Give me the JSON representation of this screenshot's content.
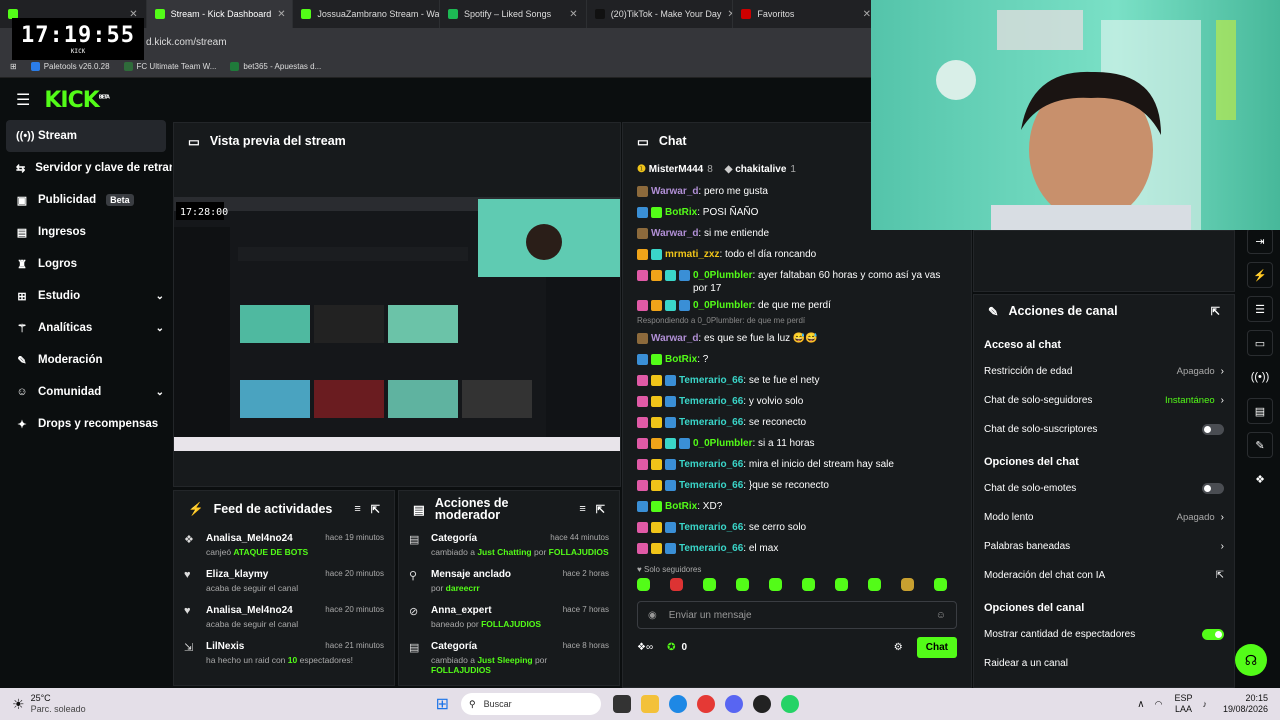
{
  "browser": {
    "tabs": [
      {
        "label": "",
        "color": "#53fc18",
        "active": false
      },
      {
        "label": "Stream - Kick Dashboard",
        "color": "#53fc18",
        "active": true
      },
      {
        "label": "JossuaZambrano Stream - Wat",
        "color": "#53fc18",
        "active": false
      },
      {
        "label": "Spotify – Liked Songs",
        "color": "#1db954",
        "active": false
      },
      {
        "label": "(20)TikTok - Make Your Day",
        "color": "#111",
        "active": false
      },
      {
        "label": "Favoritos",
        "color": "#cc0000",
        "active": false
      }
    ],
    "url": "d.kick.com/stream",
    "bookmarks": [
      "Paletools v26.0.28",
      "FC Ultimate Team W...",
      "bet365 - Apuestas d..."
    ]
  },
  "clock": {
    "time": "17:19:55",
    "sub": "KICK"
  },
  "sidebar": {
    "items": [
      {
        "label": "Stream",
        "icon": "((•))",
        "active": true
      },
      {
        "label": "Servidor y clave de retransmisión",
        "icon": "⇆"
      },
      {
        "label": "Publicidad",
        "icon": "▣",
        "badge": "Beta"
      },
      {
        "label": "Ingresos",
        "icon": "▤"
      },
      {
        "label": "Logros",
        "icon": "♜"
      },
      {
        "label": "Estudio",
        "icon": "⊞",
        "chev": true
      },
      {
        "label": "Analíticas",
        "icon": "⚚",
        "chev": true
      },
      {
        "label": "Moderación",
        "icon": "✎"
      },
      {
        "label": "Comunidad",
        "icon": "☺",
        "chev": true
      },
      {
        "label": "Drops y recompensas",
        "icon": "✦"
      }
    ]
  },
  "preview": {
    "title": "Vista previa del stream",
    "inner_time": "17:28:00"
  },
  "feed": {
    "title": "Feed de actividades",
    "rows": [
      {
        "icon": "❖",
        "name": "Analisa_Mel4no24",
        "time": "hace 19 minutos",
        "pre": "canjeó ",
        "hl": "ATAQUE DE BOTS",
        "post": ""
      },
      {
        "icon": "♥",
        "name": "Eliza_klaymy",
        "time": "hace 20 minutos",
        "pre": "acaba de seguir el canal",
        "hl": "",
        "post": ""
      },
      {
        "icon": "♥",
        "name": "Analisa_Mel4no24",
        "time": "hace 20 minutos",
        "pre": "acaba de seguir el canal",
        "hl": "",
        "post": ""
      },
      {
        "icon": "⇲",
        "name": "LilNexis",
        "time": "hace 21 minutos",
        "pre": "ha hecho un raid con ",
        "hl": "10",
        "post": " espectadores!"
      }
    ]
  },
  "mod": {
    "title": "Acciones de moderador",
    "rows": [
      {
        "icon": "▤",
        "name": "Categoría",
        "time": "hace 44 minutos",
        "pre": "cambiado a ",
        "hl": "Just Chatting",
        "mid": " por ",
        "hl2": "FOLLAJUDIOS"
      },
      {
        "icon": "⚲",
        "name": "Mensaje anclado",
        "time": "hace 2 horas",
        "pre": "por ",
        "hl": "dareecrr",
        "mid": "",
        "hl2": ""
      },
      {
        "icon": "⊘",
        "name": "Anna_expert",
        "time": "hace 7 horas",
        "pre": "baneado por ",
        "hl": "FOLLAJUDIOS",
        "mid": "",
        "hl2": ""
      },
      {
        "icon": "▤",
        "name": "Categoría",
        "time": "hace 8 horas",
        "pre": "cambiado a ",
        "hl": "Just Sleeping",
        "mid": " por ",
        "hl2": "FOLLAJUDIOS"
      }
    ]
  },
  "chat": {
    "title": "Chat",
    "top": [
      {
        "name": "MisterM444",
        "count": "8"
      },
      {
        "name": "chakitalive",
        "count": "1"
      }
    ],
    "reply_note": "Respondiendo a 0_0Plumbler: de que me perdí",
    "messages": [
      {
        "user": "Warwar_d",
        "color": "#b18fd6",
        "text": "pero me gusta",
        "badges": [
          "#8c6a3c"
        ]
      },
      {
        "user": "BotRix",
        "color": "#53fc18",
        "text": "POSI ÑAÑO",
        "badges": [
          "#3a8fd6",
          "#53fc18"
        ]
      },
      {
        "user": "Warwar_d",
        "color": "#b18fd6",
        "text": "si me entiende",
        "badges": [
          "#8c6a3c"
        ]
      },
      {
        "user": "mrmati_zxz",
        "color": "#f0c419",
        "text": "todo el día roncando",
        "badges": [
          "#f0a419",
          "#3ad6c9"
        ]
      },
      {
        "user": "0_0Plumbler",
        "color": "#53fc18",
        "text": "ayer faltaban 60 horas y como así ya vas por 17",
        "badges": [
          "#e05aa6",
          "#f0a419",
          "#3ad6c9",
          "#3a8fd6"
        ]
      },
      {
        "user": "0_0Plumbler",
        "color": "#53fc18",
        "text": "de que me perdí",
        "badges": [
          "#e05aa6",
          "#f0a419",
          "#3ad6c9",
          "#3a8fd6"
        ]
      },
      {
        "user": "Warwar_d",
        "color": "#b18fd6",
        "text": "es que se fue la luz 😅😅",
        "badges": [
          "#8c6a3c"
        ],
        "reply": true
      },
      {
        "user": "BotRix",
        "color": "#53fc18",
        "text": "?",
        "badges": [
          "#3a8fd6",
          "#53fc18"
        ]
      },
      {
        "user": "Temerario_66",
        "color": "#3ad6c9",
        "text": "se te fue el nety",
        "badges": [
          "#e05aa6",
          "#f0c419",
          "#3a8fd6"
        ]
      },
      {
        "user": "Temerario_66",
        "color": "#3ad6c9",
        "text": "y volvio solo",
        "badges": [
          "#e05aa6",
          "#f0c419",
          "#3a8fd6"
        ]
      },
      {
        "user": "Temerario_66",
        "color": "#3ad6c9",
        "text": "se reconecto",
        "badges": [
          "#e05aa6",
          "#f0c419",
          "#3a8fd6"
        ]
      },
      {
        "user": "0_0Plumbler",
        "color": "#53fc18",
        "text": "si a 11 horas",
        "badges": [
          "#e05aa6",
          "#f0a419",
          "#3ad6c9",
          "#3a8fd6"
        ]
      },
      {
        "user": "Temerario_66",
        "color": "#3ad6c9",
        "text": "mira el inicio del stream hay sale",
        "badges": [
          "#e05aa6",
          "#f0c419",
          "#3a8fd6"
        ]
      },
      {
        "user": "Temerario_66",
        "color": "#3ad6c9",
        "text": "}que se reconecto",
        "badges": [
          "#e05aa6",
          "#f0c419",
          "#3a8fd6"
        ]
      },
      {
        "user": "BotRix",
        "color": "#53fc18",
        "text": "XD?",
        "badges": [
          "#3a8fd6",
          "#53fc18"
        ]
      },
      {
        "user": "Temerario_66",
        "color": "#3ad6c9",
        "text": "se cerro solo",
        "badges": [
          "#e05aa6",
          "#f0c419",
          "#3a8fd6"
        ]
      },
      {
        "user": "Temerario_66",
        "color": "#3ad6c9",
        "text": "el max",
        "badges": [
          "#e05aa6",
          "#f0c419",
          "#3a8fd6"
        ]
      }
    ],
    "followers_only": "Solo seguidores",
    "placeholder": "Enviar un mensaje",
    "points": "0",
    "send": "Chat"
  },
  "actions": {
    "title": "Acciones de canal",
    "sections": [
      {
        "title": "Acceso al chat",
        "rows": [
          {
            "label": "Restricción de edad",
            "value": "Apagado",
            "type": "chev"
          },
          {
            "label": "Chat de solo-seguidores",
            "value": "Instantáneo",
            "type": "chev",
            "on": true
          },
          {
            "label": "Chat de solo-suscriptores",
            "value": "",
            "type": "toggle",
            "on": false
          }
        ]
      },
      {
        "title": "Opciones del chat",
        "rows": [
          {
            "label": "Chat de solo-emotes",
            "value": "",
            "type": "toggle",
            "on": false
          },
          {
            "label": "Modo lento",
            "value": "Apagado",
            "type": "chev"
          },
          {
            "label": "Palabras baneadas",
            "value": "",
            "type": "chev"
          },
          {
            "label": "Moderación del chat con IA",
            "value": "",
            "type": "ext"
          }
        ]
      },
      {
        "title": "Opciones del canal",
        "rows": [
          {
            "label": "Mostrar cantidad de espectadores",
            "value": "",
            "type": "toggle",
            "on": true
          },
          {
            "label": "Raidear a un canal",
            "value": "",
            "type": "none"
          }
        ]
      }
    ]
  },
  "taskbar": {
    "temp": "25°C",
    "weather": "Parc. soleado",
    "search": "Buscar",
    "lang": "ESP",
    "lang2": "LAA",
    "time": "20:15",
    "date": "19/08/2026"
  },
  "colors": {
    "accent": "#53fc18"
  }
}
